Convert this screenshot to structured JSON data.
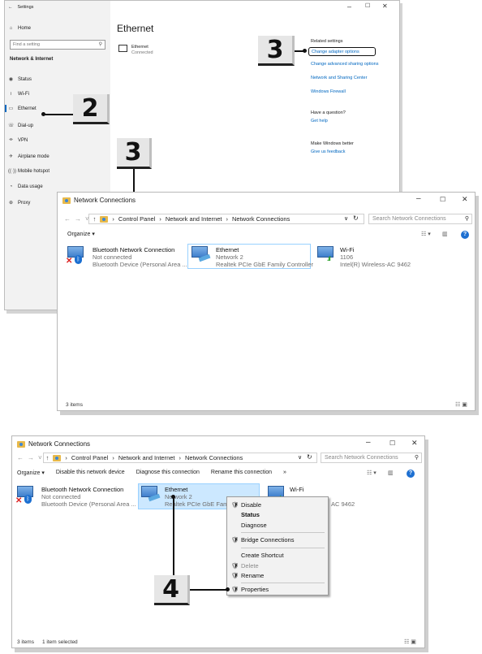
{
  "settings": {
    "app_title": "Settings",
    "home": "Home",
    "search_placeholder": "Find a setting",
    "section": "Network & Internet",
    "nav": [
      "Status",
      "Wi-Fi",
      "Ethernet",
      "Dial-up",
      "VPN",
      "Airplane mode",
      "Mobile hotspot",
      "Data usage",
      "Proxy"
    ],
    "page_title": "Ethernet",
    "adapter_name": "Ethernet",
    "adapter_status": "Connected",
    "related_title": "Related settings",
    "related_links": [
      "Change adapter options",
      "Change advanced sharing options",
      "Network and Sharing Center",
      "Windows Firewall"
    ],
    "question_title": "Have a question?",
    "question_link": "Get help",
    "better_title": "Make Windows better",
    "better_link": "Give us feedback"
  },
  "callouts": [
    "2",
    "3",
    "3",
    "4"
  ],
  "explorer1": {
    "title": "Network Connections",
    "path": [
      "Control Panel",
      "Network and Internet",
      "Network Connections"
    ],
    "search_placeholder": "Search Network Connections",
    "organize": "Organize ▾",
    "items": [
      {
        "name": "Bluetooth Network Connection",
        "line2": "Not connected",
        "line3": "Bluetooth Device (Personal Area ..."
      },
      {
        "name": "Ethernet",
        "line2": "Network 2",
        "line3": "Realtek PCIe GbE Family Controller"
      },
      {
        "name": "Wi-Fi",
        "line2": "1106",
        "line3": "Intel(R) Wireless-AC 9462"
      }
    ],
    "status": "3 items"
  },
  "explorer2": {
    "title": "Network Connections",
    "path": [
      "Control Panel",
      "Network and Internet",
      "Network Connections"
    ],
    "search_placeholder": "Search Network Connections",
    "commands": [
      "Organize ▾",
      "Disable this network device",
      "Diagnose this connection",
      "Rename this connection",
      "»"
    ],
    "items": [
      {
        "name": "Bluetooth Network Connection",
        "line2": "Not connected",
        "line3": "Bluetooth Device (Personal Area ..."
      },
      {
        "name": "Ethernet",
        "line2": "Network 2",
        "line3": "Realtek PCIe GbE Famil"
      },
      {
        "name": "Wi-Fi",
        "line2": "",
        "line3": "AC 9462"
      }
    ],
    "status_count": "3 items",
    "status_selected": "1 item selected"
  },
  "context_menu": {
    "items": [
      "Disable",
      "Status",
      "Diagnose",
      "Bridge Connections",
      "Create Shortcut",
      "Delete",
      "Rename",
      "Properties"
    ]
  },
  "glyphs": {
    "minimize": "–",
    "maximize": "☐",
    "close": "✕",
    "back": "←",
    "forward": "→",
    "up": "↑",
    "sep": "›",
    "refresh": "↻",
    "chev": "∨"
  }
}
